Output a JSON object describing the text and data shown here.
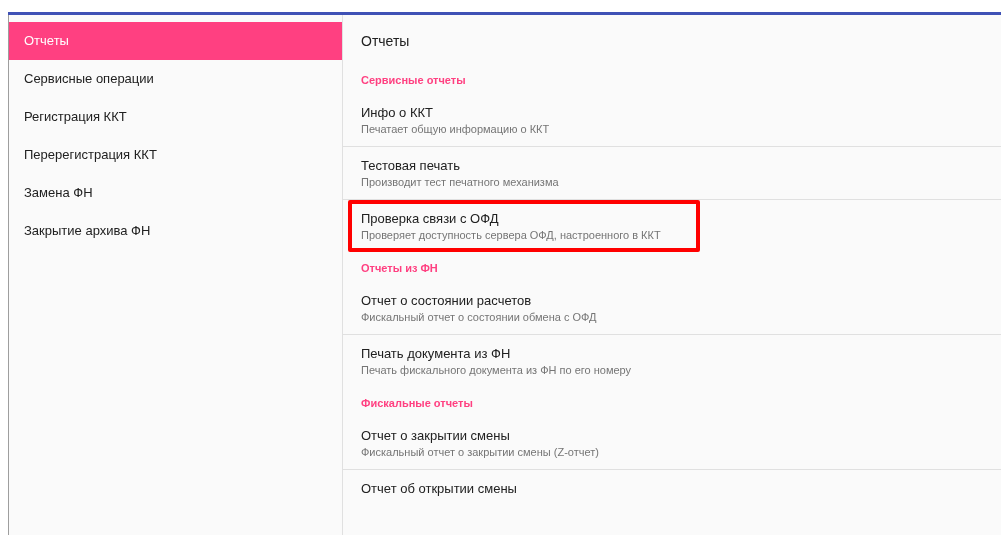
{
  "sidebar": {
    "items": [
      {
        "label": "Отчеты",
        "selected": true
      },
      {
        "label": "Сервисные операции",
        "selected": false
      },
      {
        "label": "Регистрация ККТ",
        "selected": false
      },
      {
        "label": "Перерегистрация ККТ",
        "selected": false
      },
      {
        "label": "Замена ФН",
        "selected": false
      },
      {
        "label": "Закрытие архива ФН",
        "selected": false
      }
    ]
  },
  "content": {
    "title": "Отчеты",
    "sections": [
      {
        "header": "Сервисные отчеты",
        "items": [
          {
            "title": "Инфо о ККТ",
            "subtitle": "Печатает общую информацию о ККТ",
            "highlighted": false
          },
          {
            "title": "Тестовая печать",
            "subtitle": "Производит тест печатного механизма",
            "highlighted": false
          },
          {
            "title": "Проверка связи с ОФД",
            "subtitle": "Проверяет доступность сервера ОФД, настроенного в ККТ",
            "highlighted": true
          }
        ]
      },
      {
        "header": "Отчеты из ФН",
        "items": [
          {
            "title": "Отчет о состоянии расчетов",
            "subtitle": "Фискальный отчет о состоянии обмена с ОФД",
            "highlighted": false
          },
          {
            "title": "Печать документа из ФН",
            "subtitle": "Печать фискального документа из ФН по его номеру",
            "highlighted": false
          }
        ]
      },
      {
        "header": "Фискальные отчеты",
        "items": [
          {
            "title": "Отчет о закрытии смены",
            "subtitle": "Фискальный отчет о закрытии смены (Z-отчет)",
            "highlighted": false
          },
          {
            "title": "Отчет об открытии смены",
            "highlighted": false
          }
        ]
      }
    ]
  }
}
